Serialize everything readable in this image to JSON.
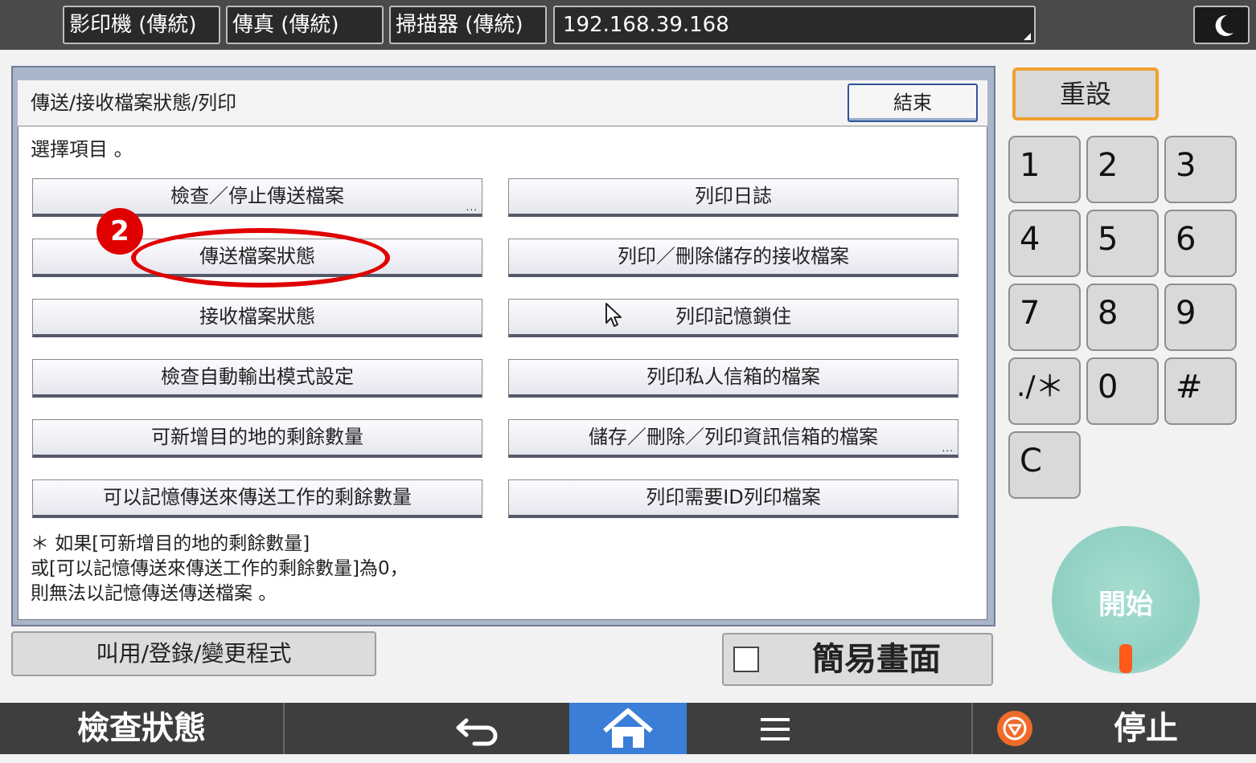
{
  "top_tabs": [
    {
      "label": "影印機 (傳統)"
    },
    {
      "label": "傳真 (傳統)"
    },
    {
      "label": "掃描器 (傳統)"
    },
    {
      "label": "192.168.39.168"
    }
  ],
  "dialog": {
    "title": "傳送/接收檔案狀態/列印",
    "end_label": "結束",
    "prompt": "選擇項目 。",
    "left_options": [
      {
        "label": "檢查／停止傳送檔案",
        "more": "..."
      },
      {
        "label": "傳送檔案狀態"
      },
      {
        "label": "接收檔案狀態"
      },
      {
        "label": "檢查自動輸出模式設定"
      },
      {
        "label": "可新增目的地的剩餘數量"
      },
      {
        "label": "可以記憶傳送來傳送工作的剩餘數量"
      }
    ],
    "right_options": [
      {
        "label": "列印日誌"
      },
      {
        "label": "列印／刪除儲存的接收檔案"
      },
      {
        "label": "列印記憶鎖住"
      },
      {
        "label": "列印私人信箱的檔案"
      },
      {
        "label": "儲存／刪除／列印資訊信箱的檔案",
        "more": "..."
      },
      {
        "label": "列印需要ID列印檔案"
      }
    ],
    "note": "＊ 如果[可新增目的地的剩餘數量]\n或[可以記憶傳送來傳送工作的剩餘數量]為0，\n則無法以記憶傳送傳送檔案 。"
  },
  "annotation": {
    "step": "2",
    "color": "#e00000"
  },
  "program_button": "叫用/登錄/變更程式",
  "simple_screen_label": "簡易畫面",
  "keypad": {
    "reset_label": "重設",
    "keys": [
      "1",
      "2",
      "3",
      "4",
      "5",
      "6",
      "7",
      "8",
      "9",
      "./＊",
      "0",
      "#",
      "C"
    ],
    "start_label": "開始"
  },
  "navbar": {
    "status_label": "檢查狀態",
    "stop_label": "停止",
    "home_color": "#3a7ed8"
  }
}
